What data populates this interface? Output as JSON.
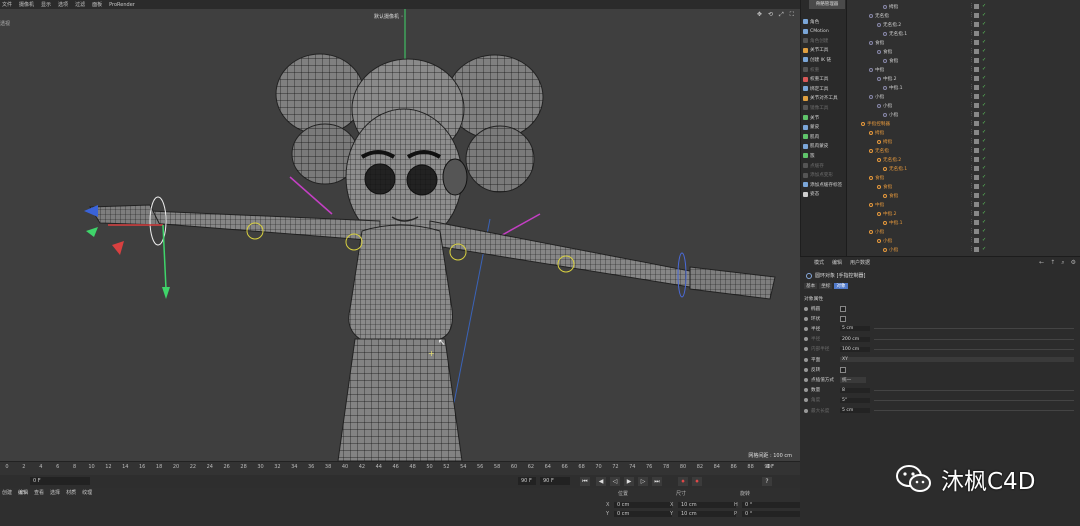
{
  "menu": [
    "文件",
    "摄像机",
    "显示",
    "选项",
    "过滤",
    "面板",
    "ProRender"
  ],
  "viewport": {
    "label": "透视",
    "camera": "默认摄像机 ◦",
    "grid_spacing": "网格间距 : 100 cm",
    "top_icons": [
      "✥",
      "⟲",
      "⤢",
      "⛶"
    ]
  },
  "timeline": {
    "ticks": [
      "0",
      "2",
      "4",
      "6",
      "8",
      "10",
      "12",
      "14",
      "16",
      "18",
      "20",
      "22",
      "24",
      "26",
      "28",
      "30",
      "32",
      "34",
      "36",
      "38",
      "40",
      "42",
      "44",
      "46",
      "48",
      "50",
      "52",
      "54",
      "56",
      "58",
      "60",
      "62",
      "64",
      "66",
      "68",
      "70",
      "72",
      "74",
      "76",
      "78",
      "80",
      "82",
      "84",
      "86",
      "88",
      "90"
    ],
    "end_frame": "0 F"
  },
  "transport": {
    "current": "0 F",
    "start": "0 F",
    "end": "90 F",
    "end2": "90 F",
    "buttons": [
      "⏮",
      "◀",
      "◁",
      "▶",
      "▷",
      "⏭",
      "⏺",
      "⏺",
      "?"
    ]
  },
  "bottom": {
    "tabs": [
      "创建",
      "编辑",
      "查看",
      "选择",
      "材质",
      "纹理"
    ],
    "active_tab": 1,
    "coord_headers": [
      "位置",
      "尺寸",
      "旋转"
    ],
    "rows": [
      {
        "axis": "X",
        "pos": "0 cm",
        "size": "10 cm",
        "rot_axis": "H",
        "rot": "0 °"
      },
      {
        "axis": "Y",
        "pos": "0 cm",
        "size": "10 cm",
        "rot_axis": "P",
        "rot": "0 °"
      }
    ]
  },
  "tools": {
    "top_label": "骨骼管理器",
    "items": [
      {
        "label": "角色",
        "color": "#7aa6d8",
        "dim": false
      },
      {
        "label": "CMotion",
        "color": "#7aa6d8",
        "dim": false
      },
      {
        "label": "角色创建",
        "color": "#555",
        "dim": true
      },
      {
        "label": "关节工具",
        "color": "#e0a040",
        "dim": false
      },
      {
        "label": "创建 IK 链",
        "color": "#7aa6d8",
        "dim": false
      },
      {
        "label": "权重",
        "color": "#555",
        "dim": true
      },
      {
        "label": "权重工具",
        "color": "#d85858",
        "dim": false
      },
      {
        "label": "绑定工具",
        "color": "#7aa6d8",
        "dim": false
      },
      {
        "label": "关节对齐工具",
        "color": "#e0a040",
        "dim": false
      },
      {
        "label": "镜像工具",
        "color": "#555",
        "dim": true
      },
      {
        "label": "关节",
        "color": "#5fc46a",
        "dim": false
      },
      {
        "label": "蒙皮",
        "color": "#7aa6d8",
        "dim": false
      },
      {
        "label": "肌肉",
        "color": "#5fc46a",
        "dim": false
      },
      {
        "label": "肌肉蒙皮",
        "color": "#7aa6d8",
        "dim": false
      },
      {
        "label": "簇",
        "color": "#5fc46a",
        "dim": false
      },
      {
        "label": "点缓存",
        "color": "#555",
        "dim": true
      },
      {
        "label": "添加点变形",
        "color": "#555",
        "dim": true
      },
      {
        "label": "添加点缓存标签",
        "color": "#7aa6d8",
        "dim": false
      },
      {
        "label": "姿态",
        "color": "#cfcfcf",
        "dim": false
      }
    ]
  },
  "objects": [
    {
      "label": "拇指",
      "indent": 30,
      "orange": false
    },
    {
      "label": "无名指",
      "indent": 16,
      "orange": false
    },
    {
      "label": "无名指.2",
      "indent": 24,
      "orange": false
    },
    {
      "label": "无名指.1",
      "indent": 30,
      "orange": false
    },
    {
      "label": "食指",
      "indent": 16,
      "orange": false
    },
    {
      "label": "食指",
      "indent": 24,
      "orange": false
    },
    {
      "label": "食指",
      "indent": 30,
      "orange": false
    },
    {
      "label": "中指",
      "indent": 16,
      "orange": false
    },
    {
      "label": "中指.2",
      "indent": 24,
      "orange": false
    },
    {
      "label": "中指.1",
      "indent": 30,
      "orange": false
    },
    {
      "label": "小指",
      "indent": 16,
      "orange": false
    },
    {
      "label": "小指",
      "indent": 24,
      "orange": false
    },
    {
      "label": "小指",
      "indent": 30,
      "orange": false
    },
    {
      "label": "手指控制器",
      "indent": 8,
      "orange": true
    },
    {
      "label": "拇指",
      "indent": 16,
      "orange": true
    },
    {
      "label": "拇指",
      "indent": 24,
      "orange": true
    },
    {
      "label": "无名指",
      "indent": 16,
      "orange": true
    },
    {
      "label": "无名指.2",
      "indent": 24,
      "orange": true
    },
    {
      "label": "无名指.1",
      "indent": 30,
      "orange": true
    },
    {
      "label": "食指",
      "indent": 16,
      "orange": true
    },
    {
      "label": "食指",
      "indent": 24,
      "orange": true
    },
    {
      "label": "食指",
      "indent": 30,
      "orange": true
    },
    {
      "label": "中指",
      "indent": 16,
      "orange": true
    },
    {
      "label": "中指.2",
      "indent": 24,
      "orange": true
    },
    {
      "label": "中指.1",
      "indent": 30,
      "orange": true
    },
    {
      "label": "小指",
      "indent": 16,
      "orange": true
    },
    {
      "label": "小指",
      "indent": 24,
      "orange": true
    },
    {
      "label": "小指",
      "indent": 30,
      "orange": true
    }
  ],
  "attributes": {
    "tabs": [
      "模式",
      "编辑",
      "用户数据"
    ],
    "nav": [
      "←",
      "↑",
      "⌕",
      "⚙"
    ],
    "title": "圆环对象 [手指控制器]",
    "subtabs": [
      "基本",
      "坐标",
      "对象"
    ],
    "active_subtab": 2,
    "section": "对象属性",
    "rows": [
      {
        "label": "椭圆",
        "kind": "check",
        "value": "",
        "dim": false
      },
      {
        "label": "环状",
        "kind": "check",
        "value": "",
        "dim": false
      },
      {
        "label": "半径",
        "kind": "value",
        "value": "5 cm",
        "dim": false
      },
      {
        "label": "半径",
        "kind": "value",
        "value": "200 cm",
        "dim": true
      },
      {
        "label": "内部半径",
        "kind": "value",
        "value": "100 cm",
        "dim": true
      },
      {
        "label": "平面",
        "kind": "wide",
        "value": "XY",
        "dim": false
      },
      {
        "label": "反转",
        "kind": "check",
        "value": "",
        "dim": false
      },
      {
        "label": "点插值方式",
        "kind": "drop",
        "value": "统一",
        "dim": false
      },
      {
        "label": "数量",
        "kind": "value",
        "value": "8",
        "dim": false
      },
      {
        "label": "角度",
        "kind": "value",
        "value": "5°",
        "dim": true
      },
      {
        "label": "最大长度",
        "kind": "value",
        "value": "5 cm",
        "dim": true
      }
    ]
  },
  "watermark": "沐枫C4D"
}
